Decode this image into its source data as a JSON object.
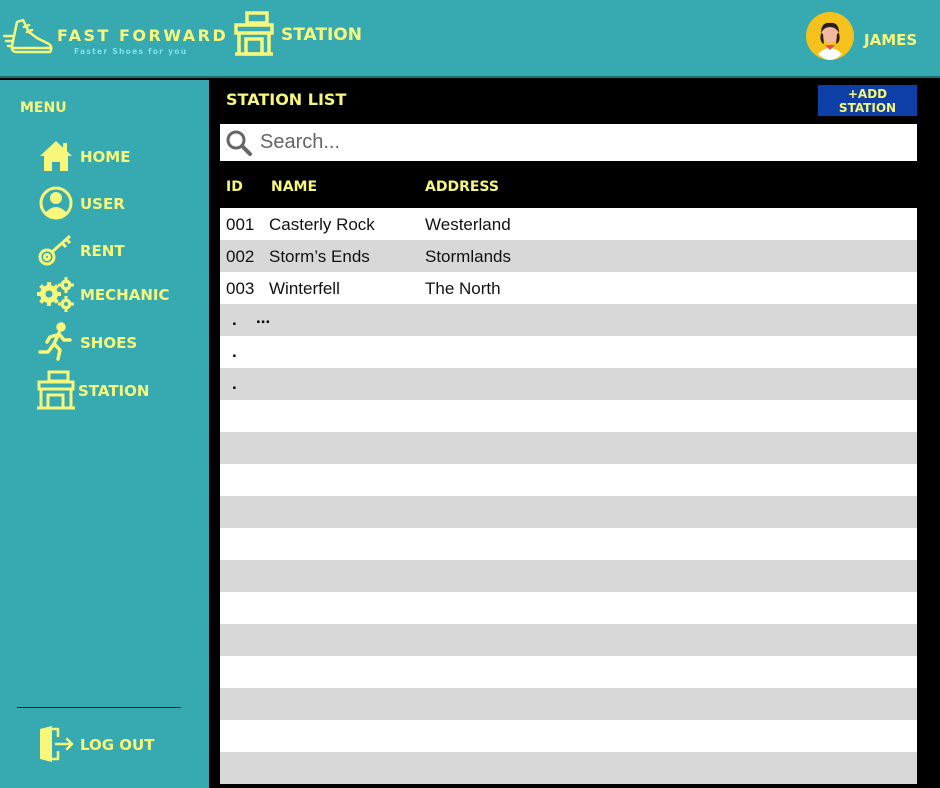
{
  "brand": {
    "name": "FAST FORWARD",
    "tagline": "Faster Shoes for you"
  },
  "header": {
    "page": "STATION",
    "user": "JAMES"
  },
  "sidebar": {
    "title": "MENU",
    "items": [
      {
        "label": "HOME",
        "icon": "home-icon"
      },
      {
        "label": "USER",
        "icon": "user-icon"
      },
      {
        "label": "RENT",
        "icon": "key-icon"
      },
      {
        "label": "MECHANIC",
        "icon": "gears-icon"
      },
      {
        "label": "SHOES",
        "icon": "runner-icon"
      },
      {
        "label": "STATION",
        "icon": "station-icon"
      }
    ],
    "logout": "LOG OUT"
  },
  "main": {
    "title": "STATION LIST",
    "add_button": "+ADD STATION",
    "search_placeholder": "Search...",
    "columns": {
      "id": "ID",
      "name": "NAME",
      "address": "ADDRESS"
    },
    "rows": [
      {
        "id": "001",
        "name": "Casterly Rock",
        "address": "Westerland"
      },
      {
        "id": "002",
        "name": "Storm’s Ends",
        "address": "Stormlands"
      },
      {
        "id": "003",
        "name": "Winterfell",
        "address": "The North"
      }
    ],
    "continuation": {
      "dot": ".",
      "ellipsis": "..."
    }
  },
  "colors": {
    "teal": "#36a9b1",
    "yellow": "#f7f77b",
    "button_blue": "#0d3fa6",
    "row_gray": "#d8d8d8"
  }
}
